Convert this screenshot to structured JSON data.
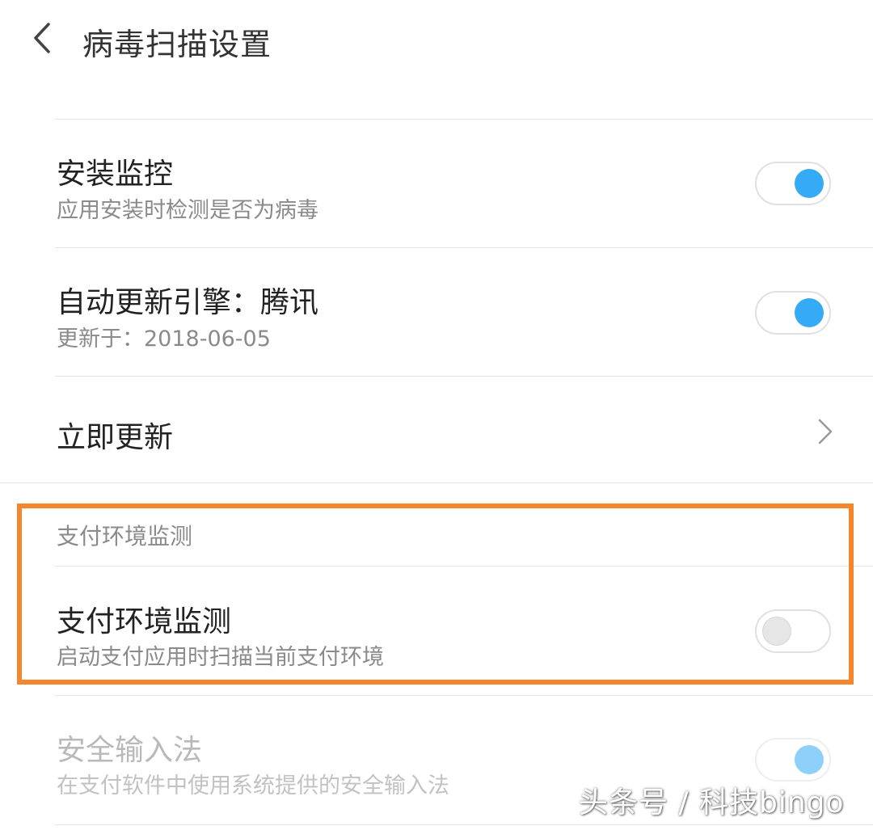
{
  "header": {
    "title": "病毒扫描设置"
  },
  "settings": {
    "install_monitor": {
      "title": "安装监控",
      "subtitle": "应用安装时检测是否为病毒",
      "enabled": true
    },
    "auto_update_engine": {
      "title": "自动更新引擎：腾讯",
      "subtitle": "更新于：2018-06-05",
      "enabled": true
    },
    "update_now": {
      "title": "立即更新"
    }
  },
  "payment_section": {
    "header": "支付环境监测",
    "payment_monitor": {
      "title": "支付环境监测",
      "subtitle": "启动支付应用时扫描当前支付环境",
      "enabled": false
    },
    "secure_keyboard": {
      "title": "安全输入法",
      "subtitle": "在支付软件中使用系统提供的安全输入法",
      "enabled": true,
      "disabled": true
    }
  },
  "watermark": "头条号 / 科技bingo",
  "colors": {
    "toggle_on": "#35aaf6",
    "highlight": "#f5862e"
  }
}
